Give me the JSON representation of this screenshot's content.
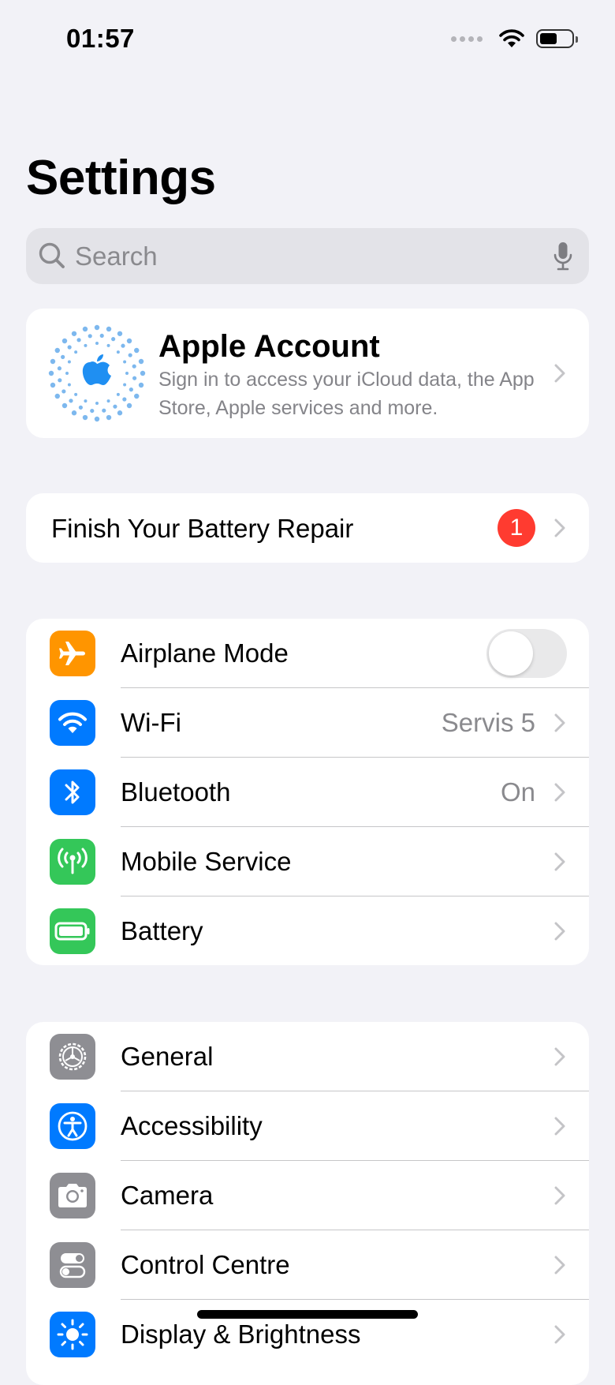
{
  "status": {
    "time": "01:57",
    "battery_level": 0.5
  },
  "header": {
    "title": "Settings"
  },
  "search": {
    "placeholder": "Search"
  },
  "account": {
    "title": "Apple Account",
    "subtitle": "Sign in to access your iCloud data, the App Store, Apple services and more."
  },
  "repair": {
    "label": "Finish Your Battery Repair",
    "badge": "1"
  },
  "connectivity": {
    "airplane": {
      "label": "Airplane Mode",
      "toggle_on": false,
      "icon": "airplane-icon",
      "color": "#ff9500"
    },
    "wifi": {
      "label": "Wi-Fi",
      "value": "Servis 5",
      "icon": "wifi-icon",
      "color": "#007aff"
    },
    "bluetooth": {
      "label": "Bluetooth",
      "value": "On",
      "icon": "bluetooth-icon",
      "color": "#007aff"
    },
    "mobile": {
      "label": "Mobile Service",
      "icon": "antenna-icon",
      "color": "#34c759"
    },
    "battery": {
      "label": "Battery",
      "icon": "battery-icon",
      "color": "#34c759"
    }
  },
  "general_group": {
    "general": {
      "label": "General",
      "icon": "gear-icon",
      "color": "#8e8e93"
    },
    "accessibility": {
      "label": "Accessibility",
      "icon": "accessibility-icon",
      "color": "#007aff"
    },
    "camera": {
      "label": "Camera",
      "icon": "camera-icon",
      "color": "#8e8e93"
    },
    "control": {
      "label": "Control Centre",
      "icon": "toggles-icon",
      "color": "#8e8e93"
    },
    "display": {
      "label": "Display & Brightness",
      "icon": "brightness-icon",
      "color": "#007aff"
    }
  },
  "colors": {
    "background": "#f2f2f7",
    "secondary_text": "#8a8a8e",
    "badge": "#ff3b30",
    "accent_blue": "#007aff"
  }
}
